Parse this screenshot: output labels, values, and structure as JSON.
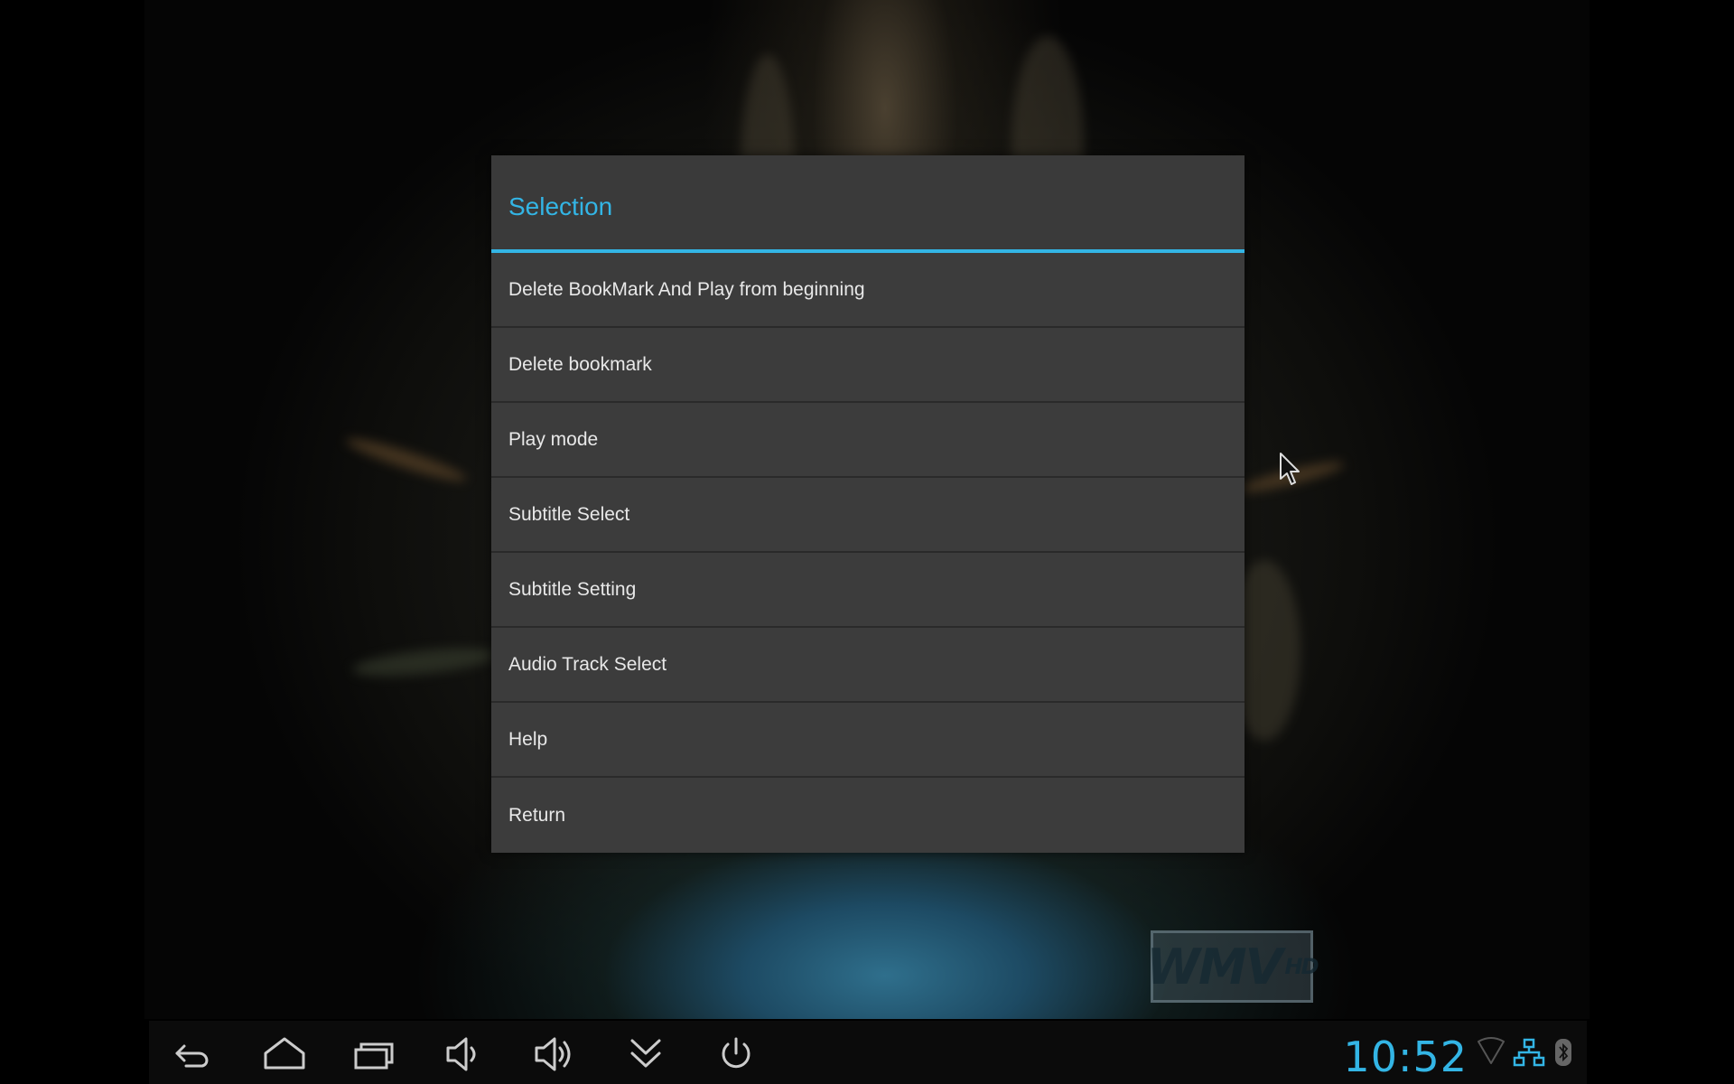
{
  "dialog": {
    "title": "Selection",
    "items": [
      {
        "label": "Delete BookMark And Play from beginning"
      },
      {
        "label": "Delete bookmark"
      },
      {
        "label": "Play mode"
      },
      {
        "label": "Subtitle Select"
      },
      {
        "label": "Subtitle Setting"
      },
      {
        "label": "Audio Track Select"
      },
      {
        "label": "Help"
      },
      {
        "label": "Return"
      }
    ]
  },
  "watermark": {
    "main": "WMV",
    "sub": "HD"
  },
  "navbar": {
    "buttons": [
      "back-icon",
      "home-icon",
      "recent-apps-icon",
      "volume-down-icon",
      "volume-up-icon",
      "hide-bar-icon",
      "power-icon"
    ]
  },
  "status": {
    "time": "10:52",
    "icons": [
      "wifi-icon",
      "ethernet-icon",
      "bluetooth-icon"
    ]
  },
  "colors": {
    "accent": "#33b5e5",
    "dialog_bg": "#3a3a3a",
    "text": "#e8e8e8"
  }
}
